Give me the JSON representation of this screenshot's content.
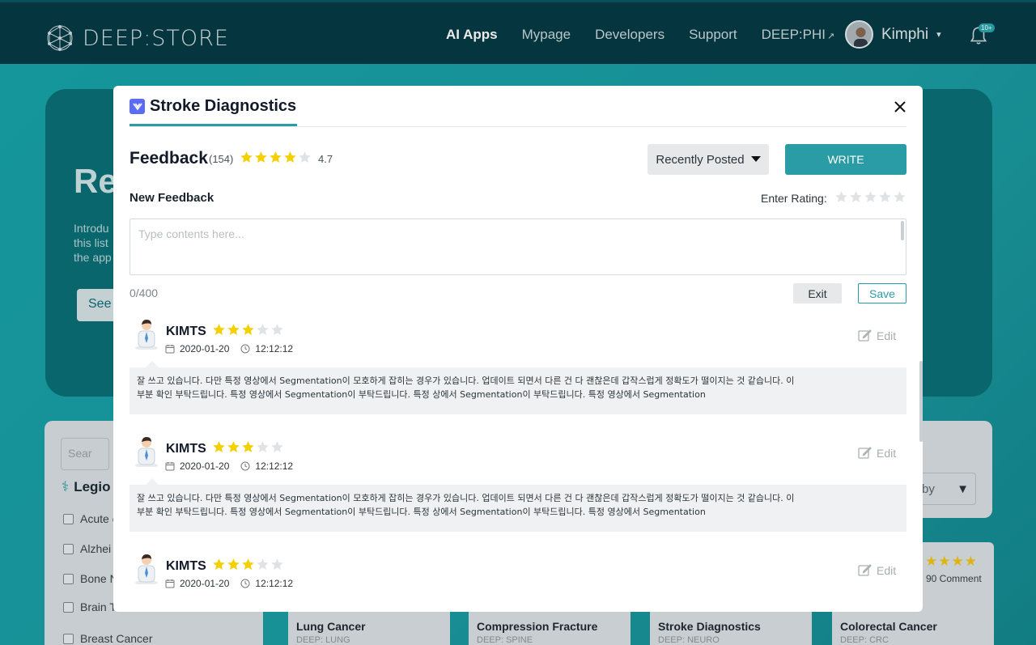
{
  "header": {
    "logo_text": "DEEP:STORE",
    "nav": [
      {
        "label": "AI Apps",
        "active": true
      },
      {
        "label": "Mypage"
      },
      {
        "label": "Developers"
      },
      {
        "label": "Support"
      },
      {
        "label": "DEEP:PHI",
        "external": true
      }
    ],
    "user_name": "Kimphi",
    "notification_badge": "10+"
  },
  "background": {
    "hero_title": "Re",
    "hero_lines": [
      "Introdu",
      "this list",
      "the app"
    ],
    "hero_button": "See",
    "search_placeholder": "Sear",
    "legion_title": "Legio",
    "legion_items": [
      "Acute c",
      "Alzhei",
      "Bone N",
      "Brain T",
      "Breast Cancer"
    ],
    "sort_label": "by",
    "cards": [
      {
        "title": "Lung Cancer",
        "sub": "DEEP: LUNG"
      },
      {
        "title": "Compression Fracture",
        "sub": "DEEP: SPINE"
      },
      {
        "title": "Stroke Diagnostics",
        "sub": "DEEP: NEURO"
      },
      {
        "title": "Colorectal Cancer",
        "sub": "DEEP: CRC"
      }
    ],
    "comment_count": "90 Comment"
  },
  "modal": {
    "title": "Stroke Diagnostics",
    "feedback_label": "Feedback",
    "feedback_count": "(154)",
    "average_rating": "4.7",
    "average_stars": 4,
    "sort_label": "Recently Posted",
    "write_label": "WRITE",
    "new_feedback_label": "New Feedback",
    "enter_rating_label": "Enter Rating:",
    "textarea_placeholder": "Type contents here...",
    "char_count": "0/400",
    "exit_label": "Exit",
    "save_label": "Save"
  },
  "reviews": [
    {
      "name": "KIMTS",
      "stars": 3,
      "date": "2020-01-20",
      "time": "12:12:12",
      "edit_label": "Edit",
      "line1": "잘 쓰고 있습니다. 다만 특정 영상에서 Segmentation이 모호하게 잡히는 경우가 있습니다. 업데이트 되면서 다른 건 다 괜찮은데 갑작스럽게 정확도가 떨이지는 것 같습니다. 이",
      "line2": "부분 확인 부탁드립니다. 특정 영상에서 Segmentation이 부탁드립니다. 특정  상에서 Segmentation이 부탁드립니다. 특정 영상에서 Segmentation"
    },
    {
      "name": "KIMTS",
      "stars": 3,
      "date": "2020-01-20",
      "time": "12:12:12",
      "edit_label": "Edit",
      "line1": "잘 쓰고 있습니다. 다만 특정 영상에서 Segmentation이 모호하게 잡히는 경우가 있습니다. 업데이트 되면서 다른 건 다 괜찮은데 갑작스럽게 정확도가 떨이지는 것 같습니다. 이",
      "line2": "부분 확인 부탁드립니다. 특정 영상에서 Segmentation이 부탁드립니다. 특정  상에서 Segmentation이 부탁드립니다. 특정 영상에서 Segmentation"
    },
    {
      "name": "KIMTS",
      "stars": 3,
      "date": "2020-01-20",
      "time": "12:12:12",
      "edit_label": "Edit",
      "line1": "",
      "line2": ""
    }
  ],
  "colors": {
    "accent": "#2a9ca6",
    "star": "#f5d000",
    "star_empty": "#e0e3e5",
    "header_bg": "#063a44"
  }
}
